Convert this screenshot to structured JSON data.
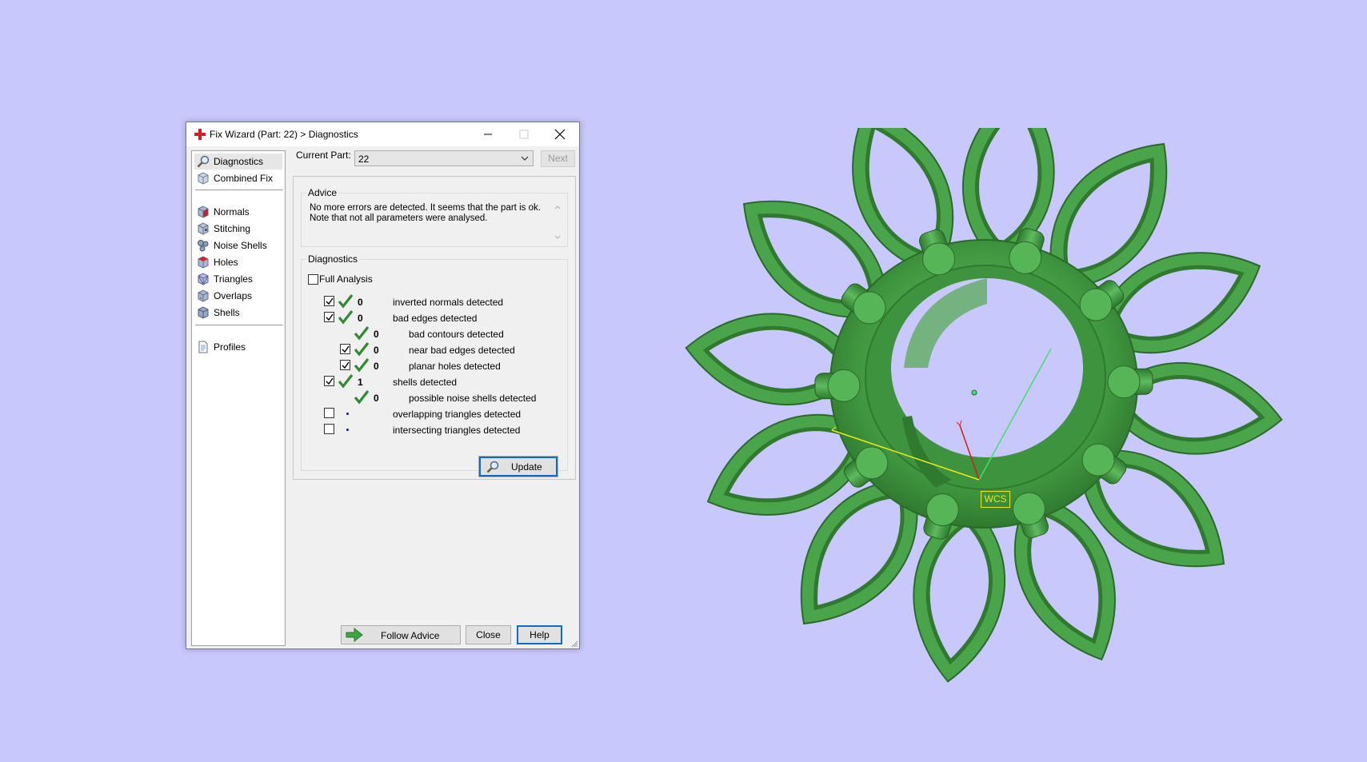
{
  "window": {
    "title": "Fix Wizard (Part: 22) > Diagnostics"
  },
  "nav": {
    "items": [
      {
        "label": "Diagnostics",
        "icon": "magnifier-icon",
        "selected": true
      },
      {
        "label": "Combined Fix",
        "icon": "cube-icon"
      },
      {
        "label": "Normals",
        "icon": "normals-cube-icon"
      },
      {
        "label": "Stitching",
        "icon": "stitching-cube-icon"
      },
      {
        "label": "Noise Shells",
        "icon": "noise-shells-icon"
      },
      {
        "label": "Holes",
        "icon": "holes-cube-icon"
      },
      {
        "label": "Triangles",
        "icon": "triangles-cube-icon"
      },
      {
        "label": "Overlaps",
        "icon": "overlaps-cube-icon"
      },
      {
        "label": "Shells",
        "icon": "shells-cube-icon"
      },
      {
        "label": "Profiles",
        "icon": "document-icon"
      }
    ]
  },
  "current_part": {
    "label": "Current Part:",
    "value": "22",
    "next_label": "Next"
  },
  "advice": {
    "title": "Advice",
    "text": "No more errors are detected. It seems that the part is ok.\nNote that not all parameters were analysed."
  },
  "diagnostics": {
    "title": "Diagnostics",
    "full_analysis_label": "Full Analysis",
    "full_analysis_checked": false,
    "rows": [
      {
        "checked": true,
        "status": "ok",
        "count": "0",
        "label": "inverted normals detected"
      },
      {
        "checked": true,
        "status": "ok",
        "count": "0",
        "label": "bad edges detected"
      },
      {
        "checked": null,
        "status": "ok",
        "count": "0",
        "label": "bad contours detected"
      },
      {
        "checked": true,
        "status": "ok",
        "count": "0",
        "label": "near bad edges detected"
      },
      {
        "checked": true,
        "status": "ok",
        "count": "0",
        "label": "planar holes detected"
      },
      {
        "checked": true,
        "status": "ok",
        "count": "1",
        "label": "shells detected"
      },
      {
        "checked": null,
        "status": "ok",
        "count": "0",
        "label": "possible noise shells detected"
      },
      {
        "checked": false,
        "status": "pending",
        "count": "",
        "label": "overlapping triangles detected"
      },
      {
        "checked": false,
        "status": "pending",
        "count": "",
        "label": "intersecting triangles detected"
      }
    ],
    "update_label": "Update"
  },
  "buttons": {
    "follow_advice": "Follow Advice",
    "close": "Close",
    "help": "Help"
  },
  "viewport": {
    "wcs_label": "WCS",
    "model_color": "#3d8f3d",
    "background_color": "#c9c8fc"
  }
}
